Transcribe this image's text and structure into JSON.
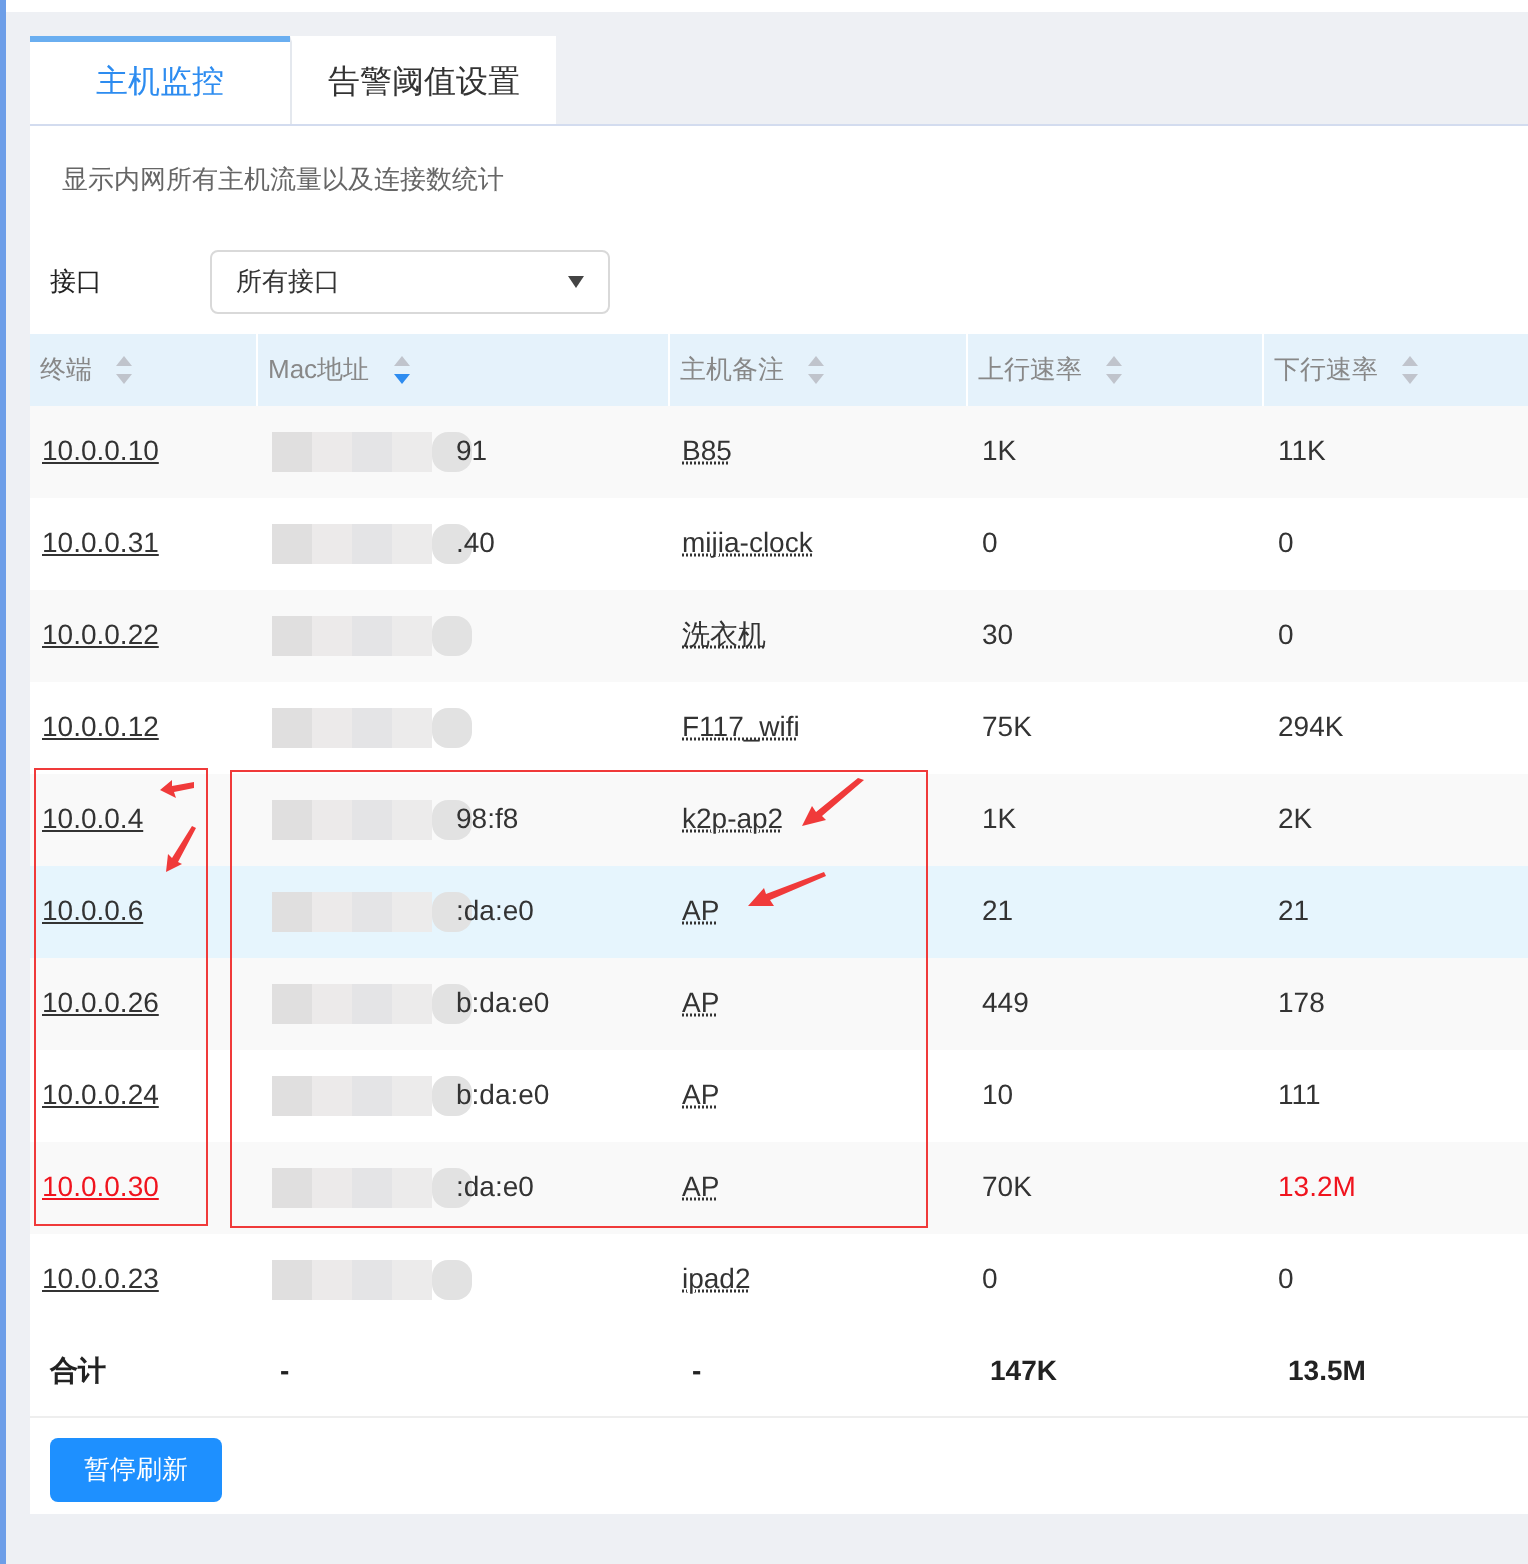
{
  "tabs": [
    {
      "label": "主机监控",
      "selected": true
    },
    {
      "label": "告警阈值设置",
      "selected": false
    }
  ],
  "description": "显示内网所有主机流量以及连接数统计",
  "interface_filter": {
    "label": "接口",
    "value": "所有接口"
  },
  "table": {
    "columns": [
      {
        "label": "终端",
        "sorted": false
      },
      {
        "label": "Mac地址",
        "sorted": true
      },
      {
        "label": "主机备注",
        "sorted": false
      },
      {
        "label": "上行速率",
        "sorted": false
      },
      {
        "label": "下行速率",
        "sorted": false
      }
    ],
    "rows": [
      {
        "ip": "10.0.0.10",
        "mac": "91",
        "note": "B85",
        "up": "1K",
        "down": "11K",
        "selected": false,
        "ip_alert": false,
        "down_alert": false
      },
      {
        "ip": "10.0.0.31",
        "mac": ".40",
        "note": "mijia-clock",
        "up": "0",
        "down": "0",
        "selected": false,
        "ip_alert": false,
        "down_alert": false
      },
      {
        "ip": "10.0.0.22",
        "note": "洗衣机",
        "up": "30",
        "down": "0",
        "selected": false,
        "ip_alert": false,
        "down_alert": false
      },
      {
        "ip": "10.0.0.12",
        "note": "F117_wifi",
        "up": "75K",
        "down": "294K",
        "selected": false,
        "ip_alert": false,
        "down_alert": false
      },
      {
        "ip": "10.0.0.4",
        "mac": "98:f8",
        "note": "k2p-ap2",
        "up": "1K",
        "down": "2K",
        "selected": false,
        "ip_alert": false,
        "down_alert": false
      },
      {
        "ip": "10.0.0.6",
        "mac": ":da:e0",
        "note": "AP",
        "up": "21",
        "down": "21",
        "selected": true,
        "ip_alert": false,
        "down_alert": false
      },
      {
        "ip": "10.0.0.26",
        "mac": "b:da:e0",
        "note": "AP",
        "up": "449",
        "down": "178",
        "selected": false,
        "ip_alert": false,
        "down_alert": false
      },
      {
        "ip": "10.0.0.24",
        "mac": "b:da:e0",
        "note": "AP",
        "up": "10",
        "down": "111",
        "selected": false,
        "ip_alert": false,
        "down_alert": false
      },
      {
        "ip": "10.0.0.30",
        "mac": ":da:e0",
        "note": "AP",
        "up": "70K",
        "down": "13.2M",
        "selected": false,
        "ip_alert": true,
        "down_alert": true
      },
      {
        "ip": "10.0.0.23",
        "note": "ipad2",
        "up": "0",
        "down": "0",
        "selected": false,
        "ip_alert": false,
        "down_alert": false
      }
    ],
    "total": {
      "label": "合计",
      "mac": "-",
      "note": "-",
      "up": "147K",
      "down": "13.5M"
    }
  },
  "pause_button": "暂停刷新"
}
